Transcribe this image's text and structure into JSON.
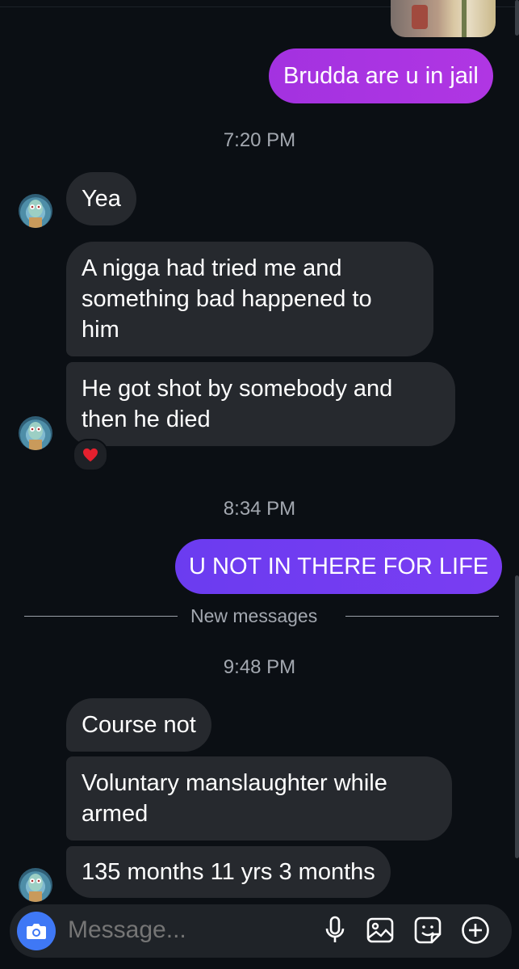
{
  "thread": {
    "image_message": "shared-image",
    "messages": [
      {
        "id": "m1",
        "sender": "me",
        "text": "Brudda are u in jail"
      },
      {
        "id": "t1",
        "type": "timestamp",
        "text": "7:20 PM"
      },
      {
        "id": "m2",
        "sender": "them",
        "text": "Yea"
      },
      {
        "id": "m3",
        "sender": "them",
        "text_lines": [
          "A nigga had tried me and",
          "something bad happened to",
          "him"
        ]
      },
      {
        "id": "m4",
        "sender": "them",
        "text_lines": [
          "He got shot by somebody and",
          "then he died"
        ],
        "reaction": "❤️"
      },
      {
        "id": "t2",
        "type": "timestamp",
        "text": "8:34 PM"
      },
      {
        "id": "m5",
        "sender": "me",
        "text": "U NOT IN THERE FOR LIFE"
      },
      {
        "id": "sep",
        "type": "separator",
        "text": "New messages"
      },
      {
        "id": "t3",
        "type": "timestamp",
        "text": "9:48 PM"
      },
      {
        "id": "m6",
        "sender": "them",
        "text": "Course not"
      },
      {
        "id": "m7",
        "sender": "them",
        "text_lines": [
          "Voluntary manslaughter while",
          "armed"
        ]
      },
      {
        "id": "m8",
        "sender": "them",
        "text": "135 months 11 yrs 3 months"
      }
    ]
  },
  "composer": {
    "placeholder": "Message...",
    "icons": [
      "camera-icon",
      "microphone-icon",
      "gallery-icon",
      "sticker-icon",
      "plus-icon"
    ]
  },
  "colors": {
    "background": "#0b0f14",
    "incoming_bubble": "#26292e",
    "outgoing_bubble_purple": "#a332e0",
    "outgoing_bubble_blue": "#6b3cf0",
    "camera_button": "#3f78f5"
  }
}
